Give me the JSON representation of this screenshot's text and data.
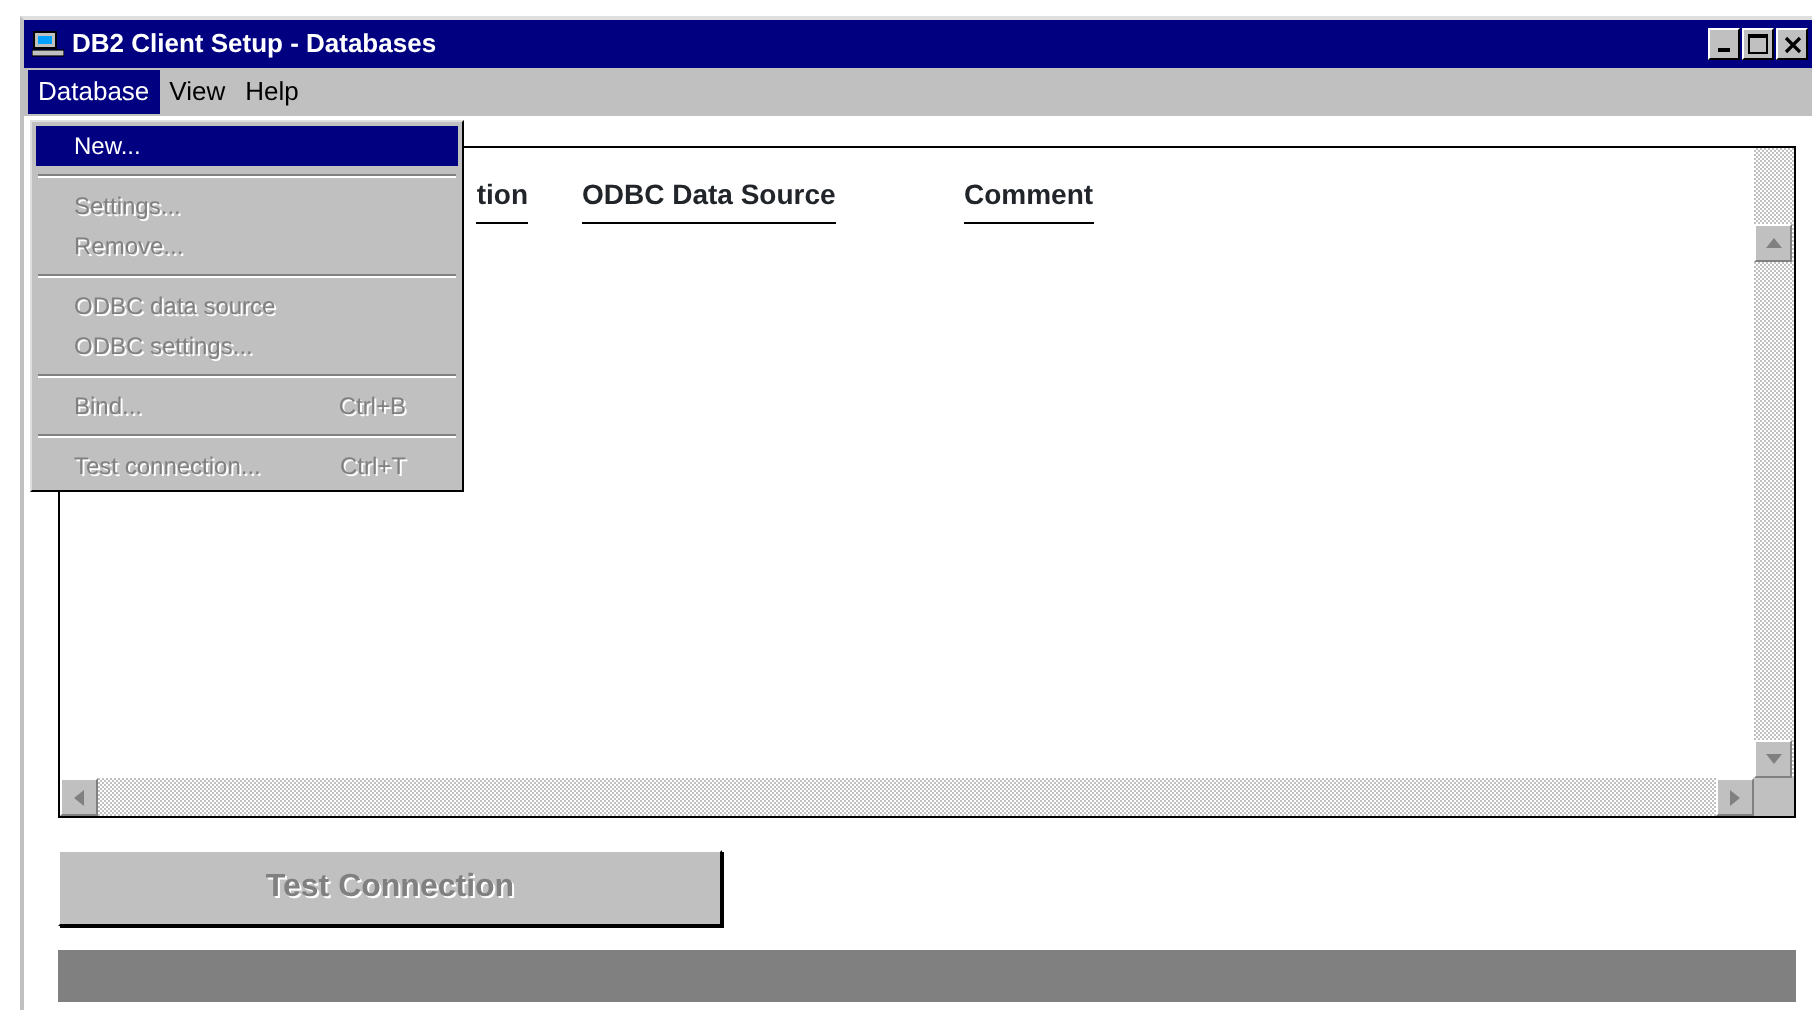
{
  "window": {
    "title": "DB2 Client Setup - Databases"
  },
  "menubar": [
    {
      "label": "Database",
      "selected": true
    },
    {
      "label": "View",
      "selected": false
    },
    {
      "label": "Help",
      "selected": false
    }
  ],
  "menu": [
    {
      "kind": "item",
      "label": "New...",
      "selected": true,
      "disabled": false
    },
    {
      "kind": "separator"
    },
    {
      "kind": "item",
      "label": "Settings...",
      "selected": false,
      "disabled": true
    },
    {
      "kind": "item",
      "label": "Remove...",
      "selected": false,
      "disabled": true
    },
    {
      "kind": "separator"
    },
    {
      "kind": "item",
      "label": "ODBC data source",
      "selected": false,
      "disabled": true
    },
    {
      "kind": "item",
      "label": "ODBC settings...",
      "selected": false,
      "disabled": true
    },
    {
      "kind": "separator"
    },
    {
      "kind": "item",
      "label": "Bind...",
      "shortcut": "Ctrl+B",
      "selected": false,
      "disabled": true
    },
    {
      "kind": "separator"
    },
    {
      "kind": "item",
      "label": "Test connection...",
      "shortcut": "Ctrl+T",
      "selected": false,
      "disabled": true
    }
  ],
  "table": {
    "columns": [
      "tion",
      "ODBC Data Source",
      "Comment"
    ]
  },
  "buttons": [
    {
      "label": "Test Connection",
      "disabled": true
    }
  ]
}
